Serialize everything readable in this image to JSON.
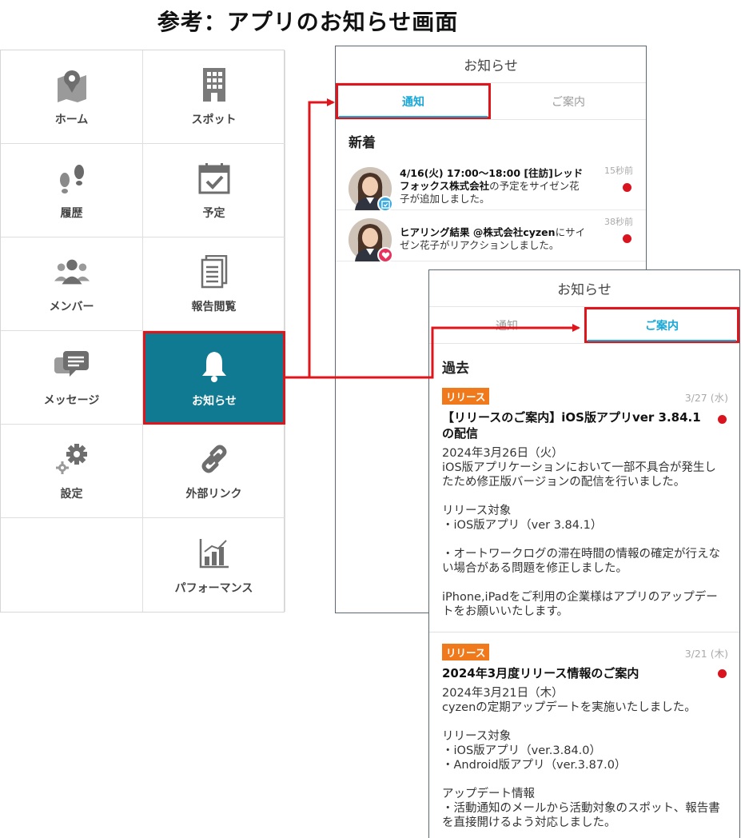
{
  "page_title": "参考：アプリのお知らせ画面",
  "menu": {
    "items": [
      {
        "label": "ホーム",
        "icon": "map-pin-icon"
      },
      {
        "label": "スポット",
        "icon": "building-icon"
      },
      {
        "label": "履歴",
        "icon": "footprints-icon"
      },
      {
        "label": "予定",
        "icon": "calendar-check-icon"
      },
      {
        "label": "メンバー",
        "icon": "group-icon"
      },
      {
        "label": "報告閲覧",
        "icon": "document-icon"
      },
      {
        "label": "メッセージ",
        "icon": "chat-bubbles-icon"
      },
      {
        "label": "お知らせ",
        "icon": "bell-icon",
        "active": true
      },
      {
        "label": "設定",
        "icon": "gears-icon"
      },
      {
        "label": "外部リンク",
        "icon": "link-icon"
      },
      {
        "label": "",
        "icon": ""
      },
      {
        "label": "パフォーマンス",
        "icon": "bar-chart-icon"
      }
    ]
  },
  "screen1": {
    "header": "お知らせ",
    "tabs": {
      "notification": "通知",
      "guide": "ご案内"
    },
    "section": "新着",
    "notifications": [
      {
        "bold": "4/16(火) 17:00〜18:00 [往訪]レッドフォックス株式会社",
        "rest": "の予定をサイゼン花子が追加しました。",
        "time": "15秒前",
        "badge": "calendar-check-icon"
      },
      {
        "bold": "ヒアリング結果 @株式会社cyzen",
        "rest": "にサイゼン花子がリアクションしました。",
        "time": "38秒前",
        "badge": "heart-icon"
      }
    ]
  },
  "screen2": {
    "header": "お知らせ",
    "tabs": {
      "notification": "通知",
      "guide": "ご案内"
    },
    "section": "過去",
    "items": [
      {
        "tag": "リリース",
        "date": "3/27 (水)",
        "title": "【リリースのご案内】iOS版アプリver 3.84.1の配信",
        "body": "2024年3月26日（火）\niOS版アプリケーションにおいて一部不具合が発生したため修正版バージョンの配信を行いました。\n\nリリース対象\n・iOS版アプリ（ver 3.84.1）\n\n・オートワークログの滞在時間の情報の確定が行えない場合がある問題を修正しました。\n\niPhone,iPadをご利用の企業様はアプリのアップデートをお願いいたします。"
      },
      {
        "tag": "リリース",
        "date": "3/21 (木)",
        "title": "2024年3月度リリース情報のご案内",
        "body": "2024年3月21日（木）\ncyzenの定期アップデートを実施いたしました。\n\nリリース対象\n・iOS版アプリ（ver.3.84.0）\n・Android版アプリ（ver.3.87.0）\n\nアップデート情報\n・活動通知のメールから活動対象のスポット、報告書を直接開けるよう対応しました。"
      }
    ]
  },
  "colors": {
    "active_menu": "#0f7a91",
    "highlight": "#e0151b",
    "tab_accent": "#18a7d6",
    "release_tag": "#f07a1b",
    "unread_dot": "#d9141f"
  }
}
